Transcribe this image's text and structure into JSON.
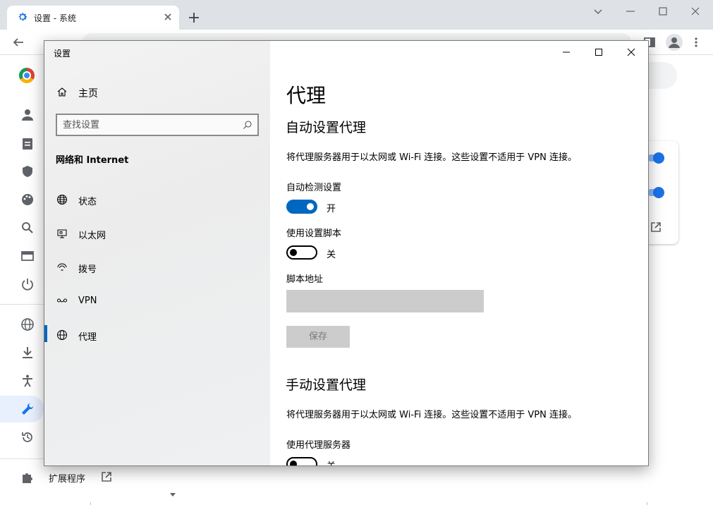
{
  "browser": {
    "tab_title": "设置 - 系统",
    "icons": {
      "tab": "gear-icon",
      "close": "close-icon",
      "new_tab": "plus-icon",
      "back": "back-arrow-icon",
      "profile": "avatar-icon",
      "menu": "more-vert-icon"
    },
    "sidebar": {
      "extensions_label": "扩展程序"
    },
    "colors": {
      "accent": "#1a73e8",
      "tabbar": "#dee1e6"
    }
  },
  "dialog": {
    "app_title": "设置",
    "home_label": "主页",
    "search_placeholder": "查找设置",
    "section_title": "网络和 Internet",
    "nav_items": [
      {
        "label": "状态",
        "icon": "globe-status-icon"
      },
      {
        "label": "以太网",
        "icon": "ethernet-monitor-icon"
      },
      {
        "label": "拨号",
        "icon": "dialup-icon"
      },
      {
        "label": "VPN",
        "icon": "vpn-icon"
      },
      {
        "label": "代理",
        "icon": "globe-icon",
        "active": true
      }
    ],
    "content": {
      "title": "代理",
      "auto": {
        "heading": "自动设置代理",
        "description": "将代理服务器用于以太网或 Wi-Fi 连接。这些设置不适用于 VPN 连接。",
        "auto_detect_label": "自动检测设置",
        "auto_detect_state": "开",
        "auto_detect_on": true,
        "use_script_label": "使用设置脚本",
        "use_script_state": "关",
        "use_script_on": false,
        "script_address_label": "脚本地址",
        "script_address_value": "",
        "save_label": "保存"
      },
      "manual": {
        "heading": "手动设置代理",
        "description": "将代理服务器用于以太网或 Wi-Fi 连接。这些设置不适用于 VPN 连接。",
        "use_proxy_label": "使用代理服务器",
        "use_proxy_state": "关",
        "use_proxy_on": false
      }
    },
    "colors": {
      "accent": "#0067c0",
      "disabled": "#cccccc"
    }
  }
}
